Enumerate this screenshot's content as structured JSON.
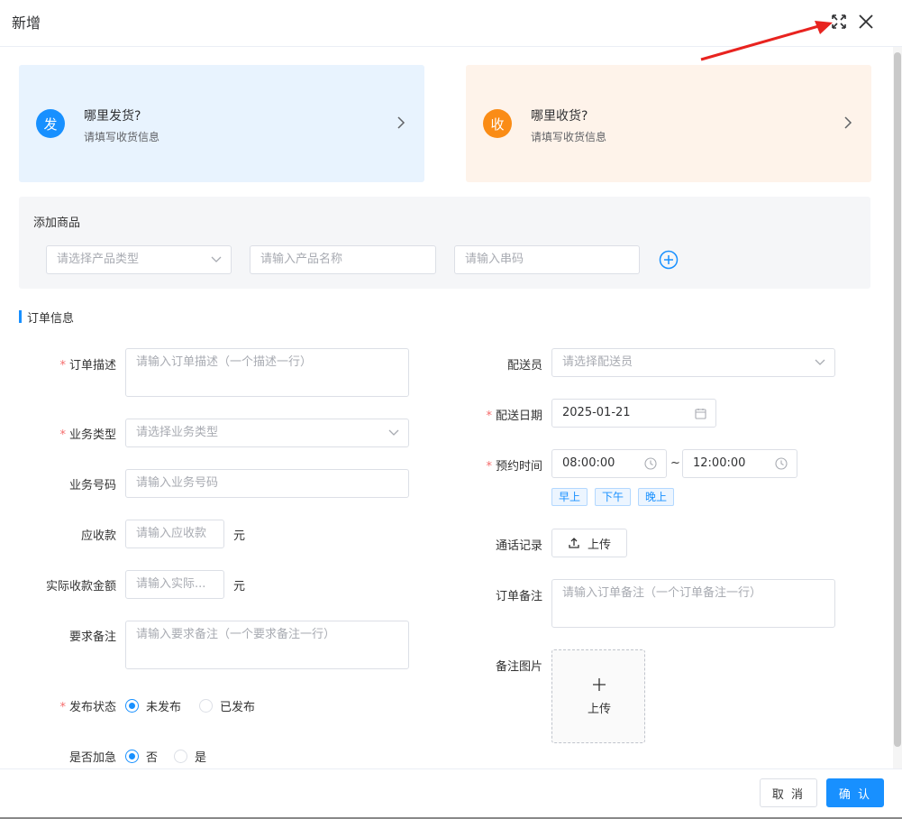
{
  "dialog": {
    "title": "新增"
  },
  "cards": {
    "send": {
      "badge": "发",
      "title": "哪里发货?",
      "subtitle": "请填写收货信息"
    },
    "receive": {
      "badge": "收",
      "title": "哪里收货?",
      "subtitle": "请填写收货信息"
    }
  },
  "goods": {
    "label": "添加商品",
    "type_placeholder": "请选择产品类型",
    "name_placeholder": "请输入产品名称",
    "serial_placeholder": "请输入串码"
  },
  "section": {
    "title": "订单信息"
  },
  "form": {
    "order_desc": {
      "label": "订单描述",
      "placeholder": "请输入订单描述（一个描述一行）"
    },
    "biz_type": {
      "label": "业务类型",
      "placeholder": "请选择业务类型"
    },
    "biz_no": {
      "label": "业务号码",
      "placeholder": "请输入业务号码"
    },
    "receivable": {
      "label": "应收款",
      "placeholder": "请输入应收款",
      "unit": "元"
    },
    "actual": {
      "label": "实际收款金额",
      "placeholder": "请输入实际...",
      "unit": "元"
    },
    "req_note": {
      "label": "要求备注",
      "placeholder": "请输入要求备注（一个要求备注一行）"
    },
    "publish": {
      "label": "发布状态",
      "options": [
        "未发布",
        "已发布"
      ],
      "selected": "未发布"
    },
    "urgent": {
      "label": "是否加急",
      "options": [
        "否",
        "是"
      ],
      "selected": "否"
    },
    "courier": {
      "label": "配送员",
      "placeholder": "请选择配送员"
    },
    "date": {
      "label": "配送日期",
      "value": "2025-01-21"
    },
    "time": {
      "label": "预约时间",
      "start": "08:00:00",
      "end": "12:00:00",
      "sep": "~",
      "presets": [
        "早上",
        "下午",
        "晚上"
      ]
    },
    "call": {
      "label": "通话记录",
      "button": "上传"
    },
    "order_note": {
      "label": "订单备注",
      "placeholder": "请输入订单备注（一个订单备注一行）"
    },
    "image": {
      "label": "备注图片",
      "button": "上传"
    }
  },
  "footer": {
    "cancel": "取 消",
    "confirm": "确 认"
  },
  "colors": {
    "primary": "#1890ff",
    "orange": "#fa8c16",
    "required": "#f56c6c",
    "annotation": "#e8231f"
  }
}
